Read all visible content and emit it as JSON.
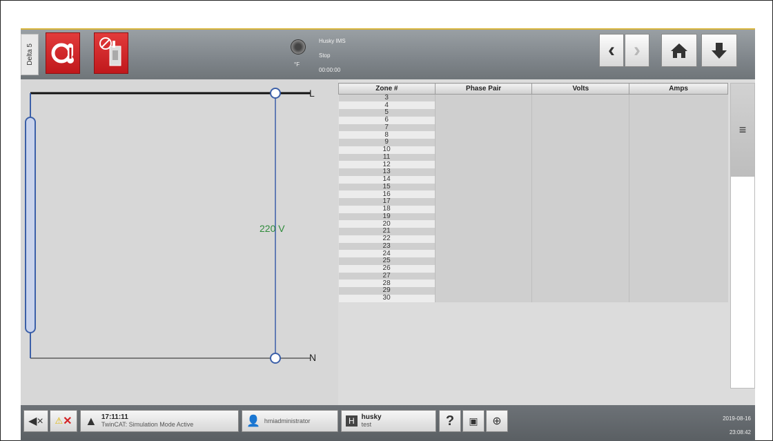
{
  "side_tab": "Delta 5",
  "machine": {
    "name": "Husky IMS",
    "state": "Stop",
    "timer": "00:00:00",
    "temp_unit": "°F"
  },
  "diagram": {
    "voltage": "220 V",
    "line_label": "L",
    "neutral_label": "N"
  },
  "table": {
    "headers": [
      "Zone #",
      "Phase Pair",
      "Volts",
      "Amps"
    ],
    "zones": [
      "3",
      "4",
      "5",
      "6",
      "7",
      "8",
      "9",
      "10",
      "11",
      "12",
      "13",
      "14",
      "15",
      "16",
      "17",
      "18",
      "19",
      "20",
      "21",
      "22",
      "23",
      "24",
      "25",
      "26",
      "27",
      "28",
      "29",
      "30"
    ]
  },
  "status": {
    "time": "17:11:11",
    "message": "TwinCAT: Simulation Mode Active",
    "user": "hmiadministrator",
    "org_name": "husky",
    "org_sub": "test",
    "date": "2019-08-16",
    "clock": "23:08:42"
  },
  "icons": {
    "alarm_button": "alarm-thermometer-icon",
    "disabled_heater": "heater-disabled-icon",
    "back": "chevron-left-icon",
    "forward": "chevron-right-icon",
    "home": "home-icon",
    "down": "arrow-down-icon",
    "menu": "hamburger-menu-icon"
  },
  "colors": {
    "accent_red": "#d42326",
    "voltage_green": "#2e8b3a",
    "header_gold": "#d8b43a",
    "diagram_blue": "#3b5fa8"
  }
}
